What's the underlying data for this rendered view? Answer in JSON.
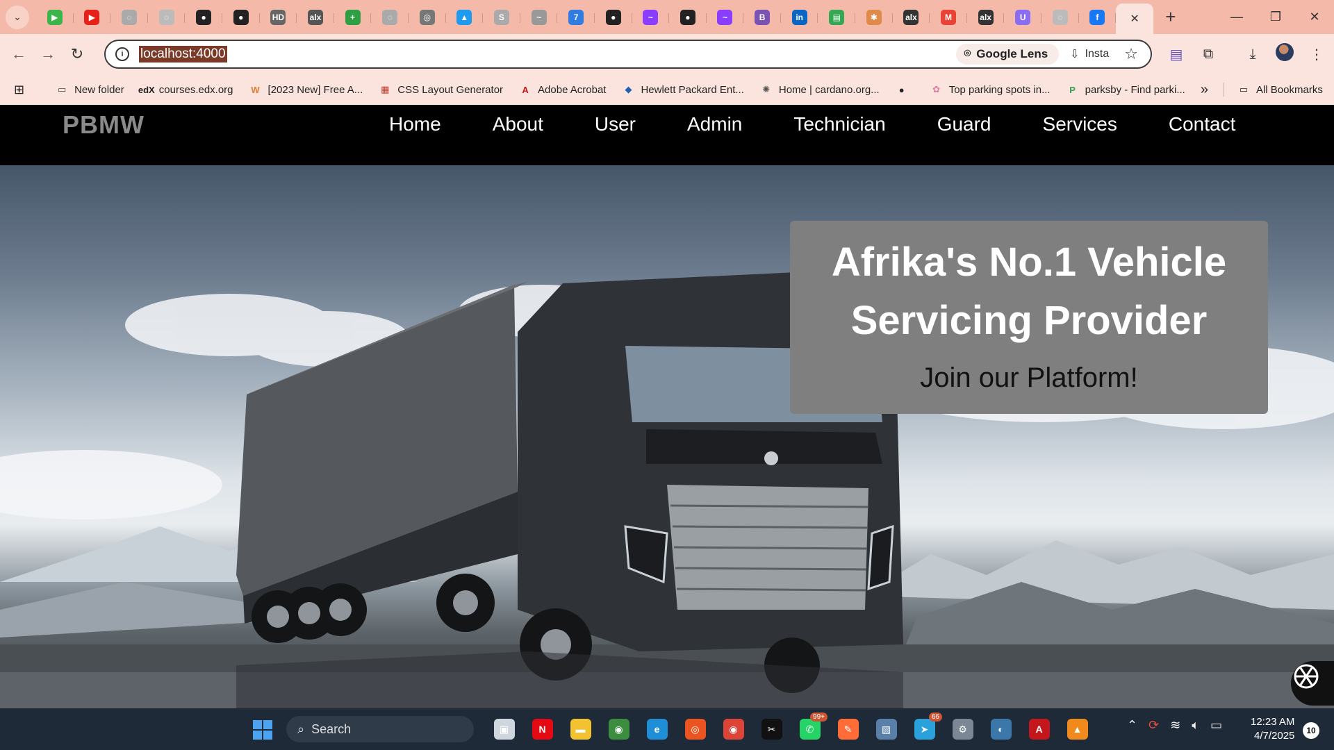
{
  "browser": {
    "url": "localhost:4000",
    "lens_label": "Google Lens",
    "insta_label": "Insta",
    "tabs": [
      {
        "icon": "play-icon",
        "color": "#3bb44a",
        "glyph": "▶"
      },
      {
        "icon": "youtube-icon",
        "color": "#e62117",
        "glyph": "▶"
      },
      {
        "icon": "generic-favicon",
        "color": "#aaaaaa",
        "glyph": "◌"
      },
      {
        "icon": "generic-favicon",
        "color": "#bbbbbb",
        "glyph": "◌"
      },
      {
        "icon": "github-icon",
        "color": "#222222",
        "glyph": "●"
      },
      {
        "icon": "github-icon",
        "color": "#222222",
        "glyph": "●"
      },
      {
        "icon": "hd-icon",
        "color": "#666666",
        "glyph": "HD"
      },
      {
        "icon": "alx-icon",
        "color": "#555555",
        "glyph": "alx"
      },
      {
        "icon": "plus-icon",
        "color": "#2ea043",
        "glyph": "+"
      },
      {
        "icon": "generic-favicon",
        "color": "#aaaaaa",
        "glyph": "◌"
      },
      {
        "icon": "target-icon",
        "color": "#777777",
        "glyph": "◎"
      },
      {
        "icon": "twitter-icon",
        "color": "#1d9bf0",
        "glyph": "▲"
      },
      {
        "icon": "s-icon",
        "color": "#aaaaaa",
        "glyph": "S"
      },
      {
        "icon": "generic-favicon",
        "color": "#999999",
        "glyph": "~"
      },
      {
        "icon": "calendar-icon",
        "color": "#2f7de1",
        "glyph": "7"
      },
      {
        "icon": "github-icon",
        "color": "#222222",
        "glyph": "●"
      },
      {
        "icon": "messenger-icon",
        "color": "#8b3dff",
        "glyph": "~"
      },
      {
        "icon": "github-icon",
        "color": "#222222",
        "glyph": "●"
      },
      {
        "icon": "messenger-icon",
        "color": "#8b3dff",
        "glyph": "~"
      },
      {
        "icon": "bootstrap-icon",
        "color": "#7952b3",
        "glyph": "B"
      },
      {
        "icon": "linkedin-icon",
        "color": "#0a66c2",
        "glyph": "in"
      },
      {
        "icon": "sheets-icon",
        "color": "#34a853",
        "glyph": "▤"
      },
      {
        "icon": "generic-favicon",
        "color": "#e08a4a",
        "glyph": "✱"
      },
      {
        "icon": "alx-icon",
        "color": "#333333",
        "glyph": "alx"
      },
      {
        "icon": "gmail-icon",
        "color": "#ea4335",
        "glyph": "M"
      },
      {
        "icon": "alx-icon",
        "color": "#333333",
        "glyph": "alx"
      },
      {
        "icon": "u-icon",
        "color": "#8a6df0",
        "glyph": "U"
      },
      {
        "icon": "generic-favicon",
        "color": "#bbbbbb",
        "glyph": "◌"
      },
      {
        "icon": "facebook-icon",
        "color": "#1877f2",
        "glyph": "f"
      }
    ],
    "bookmarks": [
      {
        "label": "New folder",
        "icon": "folder-icon",
        "glyph": "▭",
        "color": "#444444"
      },
      {
        "label": "courses.edx.org",
        "icon": "edx-icon",
        "glyph": "edX",
        "color": "#222222"
      },
      {
        "label": "[2023 New] Free A...",
        "icon": "w-icon",
        "glyph": "W",
        "color": "#e07a2f"
      },
      {
        "label": "CSS Layout Generator",
        "icon": "grid-icon",
        "glyph": "▦",
        "color": "#c0392b"
      },
      {
        "label": "Adobe Acrobat",
        "icon": "acrobat-icon",
        "glyph": "A",
        "color": "#c4161c"
      },
      {
        "label": "Hewlett Packard Ent...",
        "icon": "hpe-icon",
        "glyph": "◆",
        "color": "#1f5fb4"
      },
      {
        "label": "Home | cardano.org...",
        "icon": "cardano-icon",
        "glyph": "✺",
        "color": "#555555"
      },
      {
        "label": "",
        "icon": "globe-icon",
        "glyph": "●",
        "color": "#222222"
      },
      {
        "label": "Top parking spots in...",
        "icon": "parking-icon",
        "glyph": "✿",
        "color": "#e07aa0"
      },
      {
        "label": "parksby - Find parki...",
        "icon": "parksby-icon",
        "glyph": "P",
        "color": "#2e9e4f"
      }
    ],
    "all_bookmarks_label": "All Bookmarks"
  },
  "site": {
    "logo": "PBMW",
    "nav": [
      "Home",
      "About",
      "User",
      "Admin",
      "Technician",
      "Guard",
      "Services",
      "Contact"
    ],
    "hero_title": "Afrika's No.1 Vehicle Servicing Provider",
    "hero_subtitle": "Join our Platform!"
  },
  "taskbar": {
    "search_placeholder": "Search",
    "apps": [
      {
        "icon": "task-view-icon",
        "color": "#cfd6de",
        "glyph": "▣",
        "badge": ""
      },
      {
        "icon": "netflix-icon",
        "color": "#e50914",
        "glyph": "N",
        "badge": ""
      },
      {
        "icon": "file-explorer-icon",
        "color": "#f2c230",
        "glyph": "▬",
        "badge": ""
      },
      {
        "icon": "chrome-icon",
        "color": "#3c8d40",
        "glyph": "◉",
        "badge": ""
      },
      {
        "icon": "edge-icon",
        "color": "#1e8fd6",
        "glyph": "e",
        "badge": ""
      },
      {
        "icon": "ubuntu-icon",
        "color": "#e95420",
        "glyph": "◎",
        "badge": ""
      },
      {
        "icon": "chrome-icon",
        "color": "#db4437",
        "glyph": "◉",
        "badge": ""
      },
      {
        "icon": "capcut-icon",
        "color": "#111111",
        "glyph": "✂",
        "badge": ""
      },
      {
        "icon": "whatsapp-icon",
        "color": "#25d366",
        "glyph": "✆",
        "badge": "99+"
      },
      {
        "icon": "postman-icon",
        "color": "#ff6c37",
        "glyph": "✎",
        "badge": ""
      },
      {
        "icon": "monitor-icon",
        "color": "#5a7fa8",
        "glyph": "▨",
        "badge": ""
      },
      {
        "icon": "telegram-icon",
        "color": "#2aa1da",
        "glyph": "➤",
        "badge": "66"
      },
      {
        "icon": "settings-icon",
        "color": "#7b8794",
        "glyph": "⚙",
        "badge": ""
      },
      {
        "icon": "python-icon",
        "color": "#3b77a8",
        "glyph": "◐",
        "badge": ""
      },
      {
        "icon": "acrobat-icon",
        "color": "#c4161c",
        "glyph": "A",
        "badge": ""
      },
      {
        "icon": "vlc-icon",
        "color": "#f08a1c",
        "glyph": "▲",
        "badge": ""
      }
    ],
    "time": "12:23 AM",
    "date": "4/7/2025",
    "notifications": "10"
  }
}
